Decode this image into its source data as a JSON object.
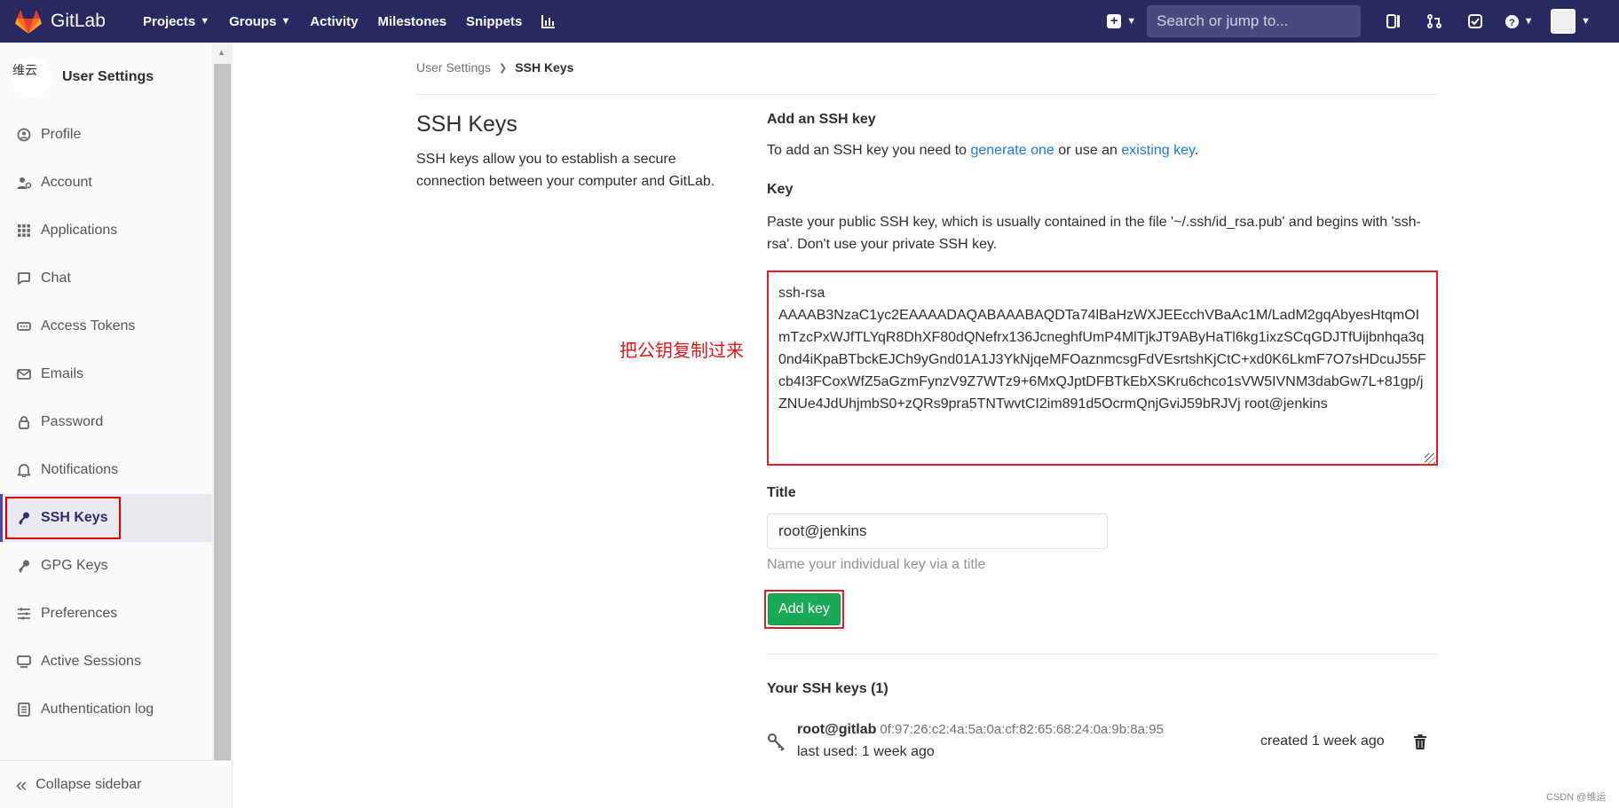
{
  "navbar": {
    "brand": "GitLab",
    "links": [
      {
        "label": "Projects",
        "dropdown": true
      },
      {
        "label": "Groups",
        "dropdown": true
      },
      {
        "label": "Activity",
        "dropdown": false
      },
      {
        "label": "Milestones",
        "dropdown": false
      },
      {
        "label": "Snippets",
        "dropdown": false
      }
    ],
    "search_placeholder": "Search or jump to...",
    "colors": {
      "bar": "#292961",
      "search": "#4a4a7e"
    }
  },
  "sidebar": {
    "context_avatar_text": "维云",
    "context_title": "User Settings",
    "items": [
      {
        "label": "Profile",
        "icon": "profile-icon",
        "active": false
      },
      {
        "label": "Account",
        "icon": "account-icon",
        "active": false
      },
      {
        "label": "Applications",
        "icon": "applications-icon",
        "active": false
      },
      {
        "label": "Chat",
        "icon": "chat-icon",
        "active": false
      },
      {
        "label": "Access Tokens",
        "icon": "access-tokens-icon",
        "active": false
      },
      {
        "label": "Emails",
        "icon": "email-icon",
        "active": false
      },
      {
        "label": "Password",
        "icon": "lock-icon",
        "active": false
      },
      {
        "label": "Notifications",
        "icon": "bell-icon",
        "active": false
      },
      {
        "label": "SSH Keys",
        "icon": "key-icon",
        "active": true
      },
      {
        "label": "GPG Keys",
        "icon": "key-icon",
        "active": false
      },
      {
        "label": "Preferences",
        "icon": "sliders-icon",
        "active": false
      },
      {
        "label": "Active Sessions",
        "icon": "monitor-icon",
        "active": false
      },
      {
        "label": "Authentication log",
        "icon": "log-icon",
        "active": false
      }
    ],
    "collapse_label": "Collapse sidebar"
  },
  "breadcrumb": {
    "parent": "User Settings",
    "current": "SSH Keys"
  },
  "intro_panel": {
    "title": "SSH Keys",
    "description": "SSH keys allow you to establish a secure connection between your computer and GitLab."
  },
  "form": {
    "heading": "Add an SSH key",
    "intro_prefix": "To add an SSH key you need to ",
    "intro_link1": "generate one",
    "intro_middle": " or use an ",
    "intro_link2": "existing key",
    "intro_suffix": ".",
    "key_label": "Key",
    "key_help": "Paste your public SSH key, which is usually contained in the file '~/.ssh/id_rsa.pub' and begins with 'ssh-rsa'. Don't use your private SSH key.",
    "key_value": "ssh-rsa\nAAAAB3NzaC1yc2EAAAADAQABAAABAQDTa74lBaHzWXJEEcchVBaAc1M/LadM2gqAbyesHtqmOImTzcPxWJfTLYqR8DhXF80dQNefrx136JcneghfUmP4MlTjkJT9AByHaTl6kg1ixzSCqGDJTfUijbnhqa3q0nd4iKpaBTbckEJCh9yGnd01A1J3YkNjqeMFOaznmcsgFdVEsrtshKjCtC+xd0K6LkmF7O7sHDcuJ55Fcb4I3FCoxWfZ5aGzmFynzV9Z7WTz9+6MxQJptDFBTkEbXSKru6chco1sVW5IVNM3dabGw7L+81gp/jZNUe4JdUhjmbS0+zQRs9pra5TNTwvtCI2im891d5OcrmQnjGviJ59bRJVj root@jenkins",
    "title_label": "Title",
    "title_value": "root@jenkins",
    "title_help": "Name your individual key via a title",
    "submit_label": "Add key",
    "submit_color": "#1aaa55"
  },
  "your_keys": {
    "heading": "Your SSH keys (1)",
    "keys": [
      {
        "name": "root@gitlab",
        "fingerprint": "0f:97:26:c2:4a:5a:0a:cf:82:65:68:24:0a:9b:8a:95",
        "last_used": "last used: 1 week ago",
        "created": "created 1 week ago"
      }
    ]
  },
  "annotation": "把公钥复制过来",
  "watermark": "CSDN @维运"
}
